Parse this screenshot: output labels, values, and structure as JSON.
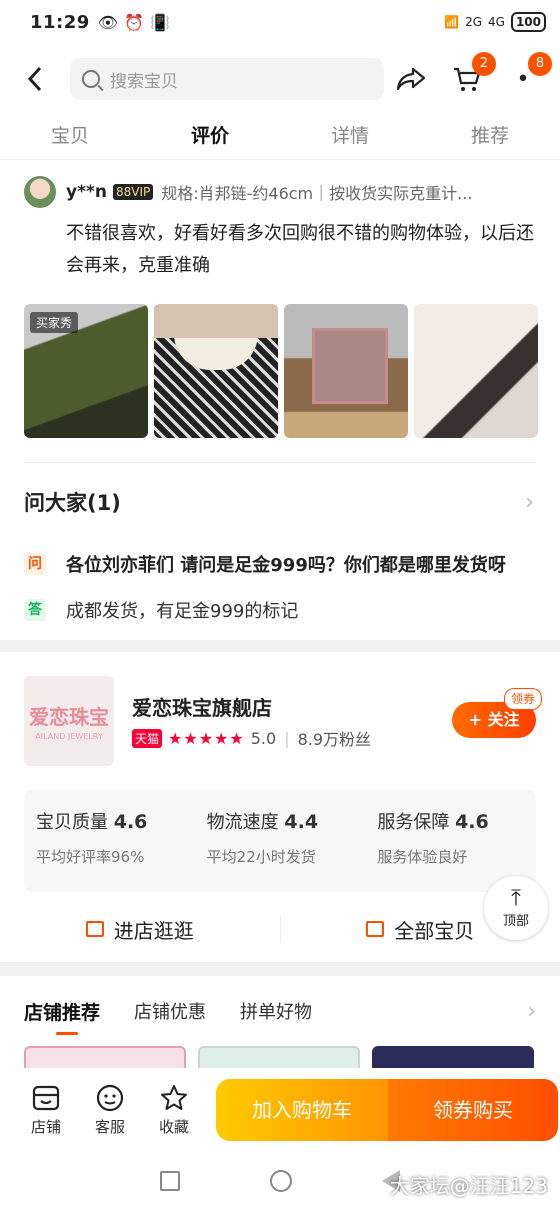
{
  "status": {
    "time": "11:29",
    "battery": "100",
    "net1": "2G",
    "net2": "4G"
  },
  "search": {
    "placeholder": "搜索宝贝"
  },
  "cart_badge": "2",
  "more_badge": "8",
  "tabs": [
    "宝贝",
    "评价",
    "详情",
    "推荐"
  ],
  "review": {
    "username": "y**n",
    "vip": "88VIP",
    "spec": "规格:肖邦链-约46cm｜按收货实际克重计...",
    "text": "不错很喜欢，好看好看多次回购很不错的购物体验，以后还会再来，克重准确",
    "buyer_tag": "买家秀"
  },
  "qa": {
    "title": "问大家(1)",
    "q_tag": "问",
    "a_tag": "答",
    "question": "各位刘亦菲们 请问是足金999吗？你们都是哪里发货呀",
    "answer": "成都发货，有足金999的标记"
  },
  "shop": {
    "logo_cn": "爱恋珠宝",
    "logo_en": "AILAND JEWELRY",
    "name": "爱恋珠宝旗舰店",
    "tmall": "天猫",
    "rating": "5.0",
    "fans": "8.9万粉丝",
    "follow": "+ 关注",
    "coupon": "领券",
    "scores": [
      {
        "label": "宝贝质量",
        "value": "4.6",
        "sub": "平均好评率96%"
      },
      {
        "label": "物流速度",
        "value": "4.4",
        "sub": "平均22小时发货"
      },
      {
        "label": "服务保障",
        "value": "4.6",
        "sub": "服务体验良好"
      }
    ],
    "enter": "进店逛逛",
    "all": "全部宝贝"
  },
  "totop": "顶部",
  "rec": {
    "tabs": [
      "店铺推荐",
      "店铺优惠",
      "拼单好物"
    ]
  },
  "bottom": {
    "shop": "店铺",
    "service": "客服",
    "fav": "收藏",
    "add_cart": "加入购物车",
    "buy": "领券购买"
  },
  "watermark": "大家坛@汪汪123",
  "colors": {
    "accent": "#ff5000",
    "tmall": "#ff0036"
  }
}
